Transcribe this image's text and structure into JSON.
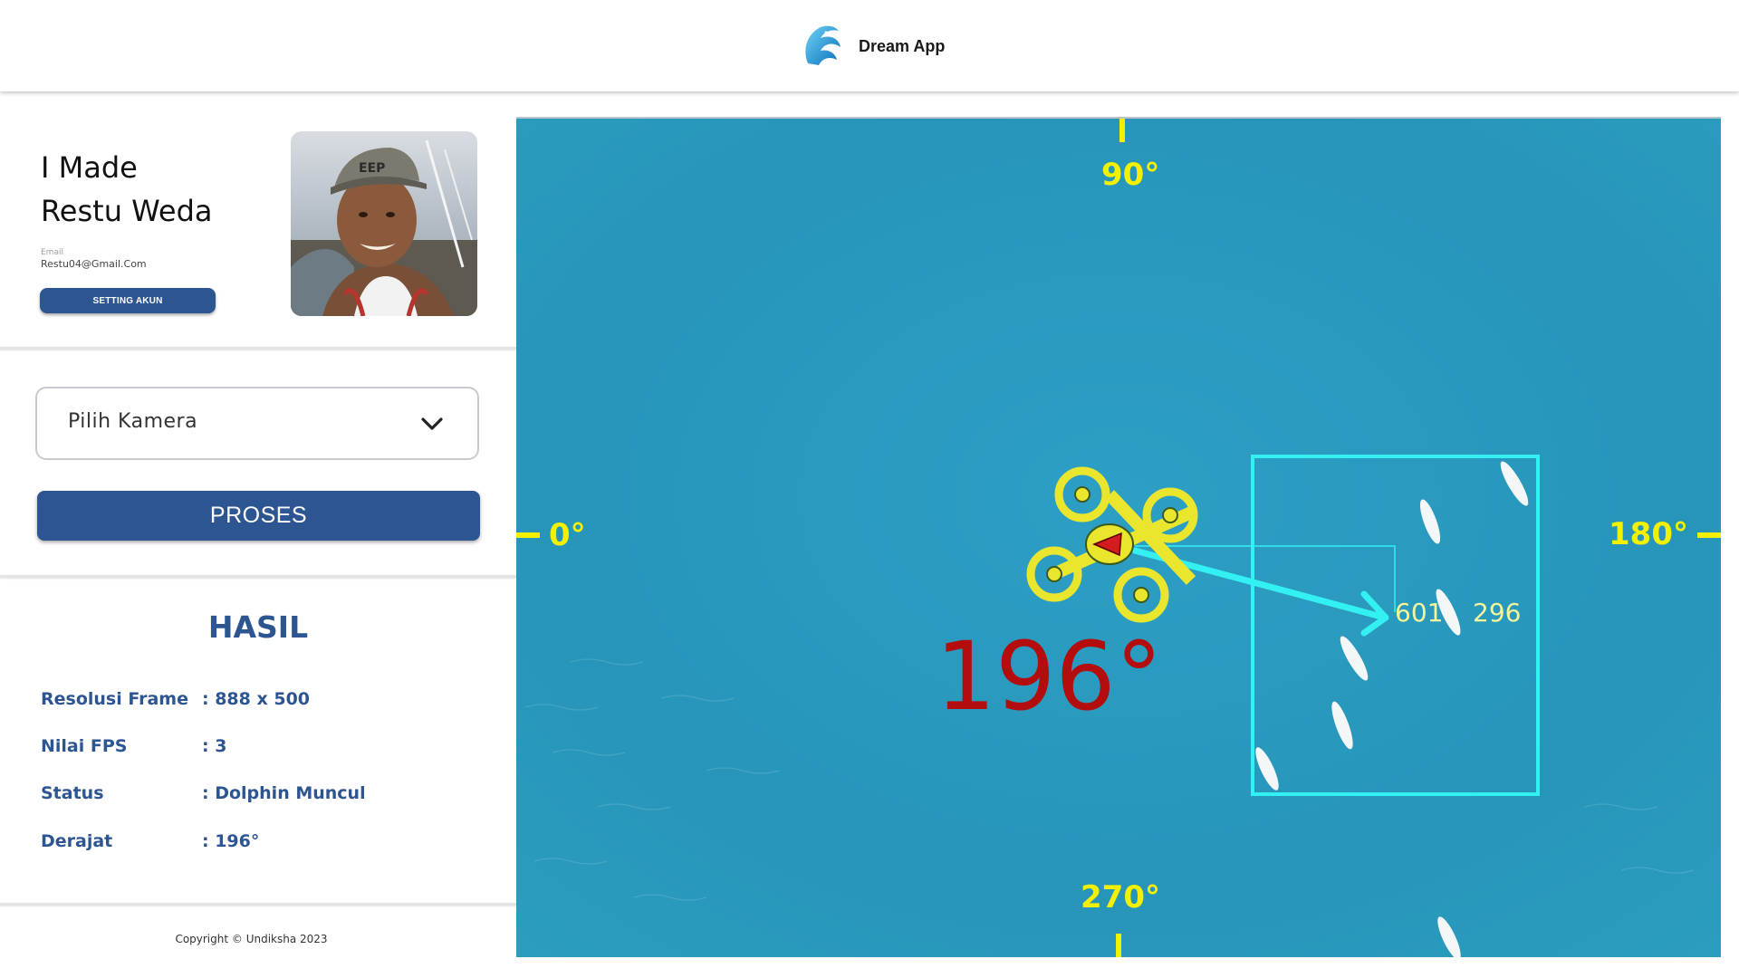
{
  "header": {
    "app_name": "Dream App",
    "logo_icon": "dolphin-wave-logo-icon"
  },
  "profile": {
    "name_line1": "I Made",
    "name_line2": "Restu Weda",
    "email_label": "Email",
    "email": "Restu04@Gmail.Com",
    "setting_button": "SETTING AKUN"
  },
  "camera_select": {
    "selected": "Pilih Kamera",
    "icon": "chevron-down-icon"
  },
  "process_button": "PROSES",
  "result": {
    "title": "HASIL",
    "rows": [
      {
        "label": "Resolusi Frame",
        "value": ": 888 x 500"
      },
      {
        "label": "Nilai FPS",
        "value": ": 3"
      },
      {
        "label": "Status",
        "value": ": Dolphin Muncul"
      },
      {
        "label": "Derajat",
        "value": ": 196°"
      }
    ]
  },
  "footer": {
    "copyright": "Copyright © Undiksha 2023"
  },
  "camera_view": {
    "compass": {
      "top": "90°",
      "left": "0°",
      "right": "180°",
      "bottom": "270°"
    },
    "heading": "196°",
    "target_x": "601",
    "target_y": "296",
    "colors": {
      "compass": "#f3f000",
      "box": "#33f0f3",
      "heading": "#b30d0d",
      "sea": "#2a9bbf"
    }
  }
}
